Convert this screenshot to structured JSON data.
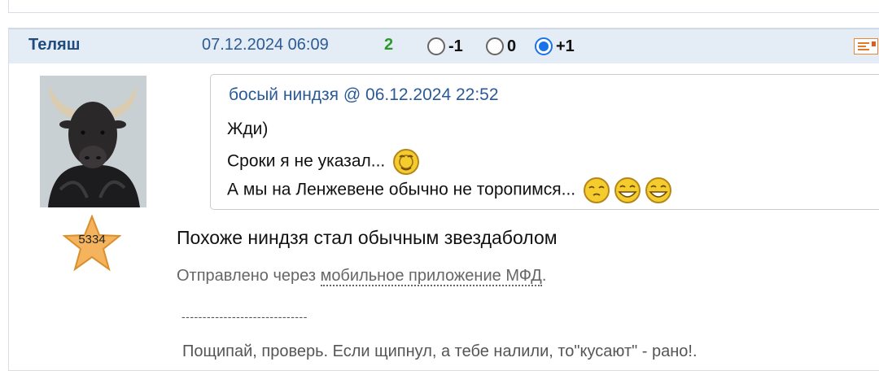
{
  "post": {
    "author": "Теляш",
    "datetime": "07.12.2024 06:09",
    "score": "2",
    "votes": [
      {
        "label": "-1",
        "checked": false
      },
      {
        "label": "0",
        "checked": false
      },
      {
        "label": "+1",
        "checked": true
      }
    ],
    "rating": "5334",
    "quote": {
      "header": "босый ниндзя @ 06.12.2024 22:52",
      "lines": [
        "Жди)",
        "Сроки я не указал...",
        "А мы на Ленжевене обычно не торопимся..."
      ]
    },
    "message": "Похоже ниндзя стал обычным звездаболом",
    "sent_via": {
      "prefix": "Отправлено через ",
      "link": "мобильное приложение МФД",
      "suffix": "."
    },
    "signature_separator": "------------------------------",
    "signature": "Пощипай, проверь. Если щипнул, а тебе налили, то\"кусают\" - рано!."
  },
  "colors": {
    "header_bg": "#e4ecf6",
    "author": "#1f4b7f",
    "date": "#2c5b94",
    "score": "#2a9a2a",
    "radio_checked": "#1a73e8",
    "star": "#f4b35c"
  },
  "icons": [
    "menu-icon",
    "smiley-icon",
    "star-icon",
    "avatar-bull"
  ]
}
